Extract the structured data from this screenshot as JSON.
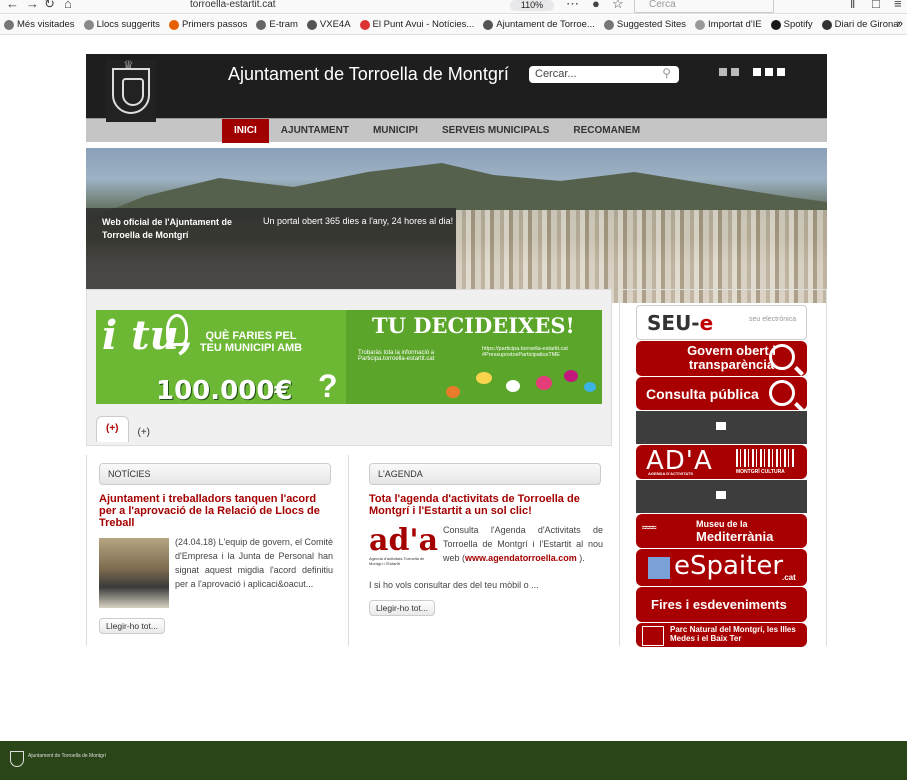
{
  "browser": {
    "url": "torroella-estartit.cat",
    "zoom": "110%",
    "search_placeholder": "Cerca",
    "bookmarks": [
      {
        "label": "Més visitades",
        "color": "#777"
      },
      {
        "label": "Llocs suggerits",
        "color": "#888"
      },
      {
        "label": "Primers passos",
        "color": "#e66000"
      },
      {
        "label": "E-tram",
        "color": "#666"
      },
      {
        "label": "VXE4A",
        "color": "#555"
      },
      {
        "label": "El Punt Avui - Notícies...",
        "color": "#d33"
      },
      {
        "label": "Ajuntament de Torroe...",
        "color": "#555"
      },
      {
        "label": "Suggested Sites",
        "color": "#777"
      },
      {
        "label": "Importat d'IE",
        "color": "#999"
      },
      {
        "label": "Spotify",
        "color": "#1a1a1a"
      },
      {
        "label": "Diari de Girona:",
        "color": "#333"
      }
    ]
  },
  "header": {
    "title": "Ajuntament de Torroella de Montgrí",
    "search_value": "Cercar..."
  },
  "nav": [
    {
      "label": "INICI",
      "active": true
    },
    {
      "label": "AJUNTAMENT",
      "active": false
    },
    {
      "label": "MUNICIPI",
      "active": false
    },
    {
      "label": "SERVEIS MUNICIPALS",
      "active": false
    },
    {
      "label": "RECOMANEM",
      "active": false
    }
  ],
  "hero": {
    "caption_left": "Web oficial de l'Ajuntament de Torroella de Montgrí",
    "caption_right": "Un portal obert 365 dies a l'any, 24 hores al dia!"
  },
  "banner": {
    "i_tu": "i tu,",
    "que_faries": "QUÈ FARIES PEL TEU MUNICIPI AMB",
    "amount": "100.000€",
    "qmark": "?",
    "headline": "TU DECIDEIXES!",
    "info1": "Trobaràs tota la informació a Participa.torroella-estartit.cat",
    "info2": "https://participa.torroella-estartit.cat #PressupostosParticipatiusTME"
  },
  "tabs": [
    {
      "label": "(+)",
      "active": true
    },
    {
      "label": "(+)",
      "active": false
    }
  ],
  "news": {
    "header": "NOTÍCIES",
    "title": "Ajuntament i treballadors tanquen l'acord per a l'aprovació de la Relació de Llocs de Treball",
    "text": "(24.04.18) L'equip de govern, el Comitè d'Empresa i la Junta de Personal han signat aquest migdia l'acord definitiu per a l'aprovació i aplicaci&oacut...",
    "readmore": "Llegir-ho tot..."
  },
  "agenda": {
    "header": "L'AGENDA",
    "title": "Tota l'agenda d'activitats de Torroella de Montgrí i l'Estartit a un sol clic!",
    "logo": "ad'a",
    "logo_sub": "Agenda d'activitats Torroella de Montgrí i l'Estartit",
    "text": "Consulta l'Agenda d'Activitats de Torroella de Montgrí i l'Estartit al nou web (",
    "link": "www.agendatorroella.com",
    "text_after": " ).",
    "text2": "I si ho vols consultar des del teu mòbil o ...",
    "readmore": "Llegir-ho tot..."
  },
  "sidebar": {
    "seu": "SEU-",
    "seu_e": "e",
    "seu_small": "seu electrònica",
    "govern": "Govern obert i transparència",
    "consulta": "Consulta pública",
    "ada": "AD'A",
    "ada_sub": "AGENDA D'ACTIVITATS",
    "montgri": "MONTGRÍ CULTURA",
    "museu_small": "Museu de la",
    "museu": "Mediterrània",
    "espai": "eSpaiter",
    "espai_cat": ".cat",
    "fires": "Fires i esdeveniments",
    "parc": "Parc Natural del Montgrí, les Illes Medes i el Baix Ter"
  },
  "footer": {
    "logo_text": "Ajuntament de Torroella de Montgrí"
  }
}
